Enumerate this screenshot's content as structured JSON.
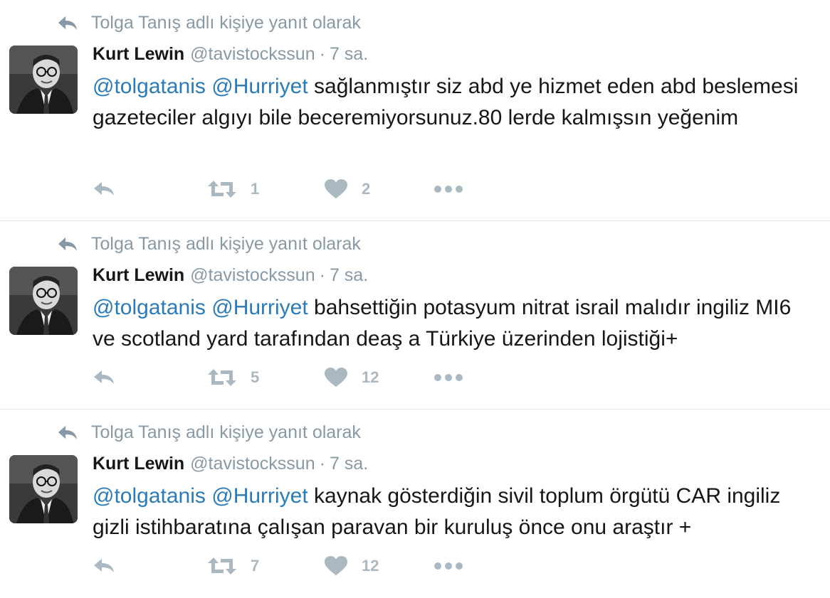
{
  "colors": {
    "mention": "#2b7bb9",
    "muted": "#8899a6",
    "action_icons": "#aab8c2",
    "divider": "#e1e8ed"
  },
  "tweets": [
    {
      "context": "Tolga Tanış adlı kişiye yanıt olarak",
      "name": "Kurt Lewin",
      "handle": "@tavistockssun",
      "dot": "·",
      "time": "7 sa.",
      "mention1": "@tolgatanis",
      "mention2": "@Hurriyet",
      "body": "sağlanmıştır siz abd ye hizmet eden abd beslemesi gazeteciler algıyı bile beceremiyorsunuz.80 lerde kalmışsın yeğenim",
      "retweets": "1",
      "likes": "2"
    },
    {
      "context": "Tolga Tanış adlı kişiye yanıt olarak",
      "name": "Kurt Lewin",
      "handle": "@tavistockssun",
      "dot": "·",
      "time": "7 sa.",
      "mention1": "@tolgatanis",
      "mention2": "@Hurriyet",
      "body": "bahsettiğin potasyum nitrat israil malıdır ingiliz MI6 ve scotland yard tarafından deaş a Türkiye üzerinden lojistiği+",
      "retweets": "5",
      "likes": "12"
    },
    {
      "context": "Tolga Tanış adlı kişiye yanıt olarak",
      "name": "Kurt Lewin",
      "handle": "@tavistockssun",
      "dot": "·",
      "time": "7 sa.",
      "mention1": "@tolgatanis",
      "mention2": "@Hurriyet",
      "body": "kaynak gösterdiğin sivil toplum örgütü CAR ingiliz gizli istihbaratına çalışan paravan bir kuruluş önce onu araştır +",
      "retweets": "7",
      "likes": "12"
    }
  ]
}
